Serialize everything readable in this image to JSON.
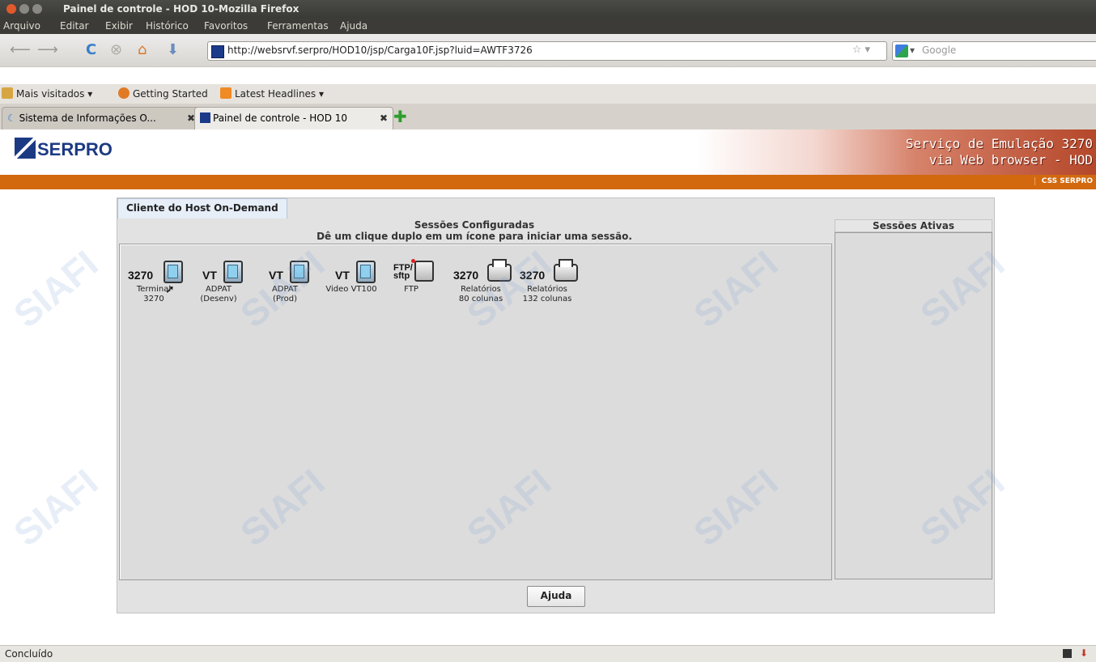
{
  "window": {
    "title": "Painel de controle - HOD 10-Mozilla Firefox"
  },
  "menu": [
    "Arquivo",
    "Editar",
    "Exibir",
    "Histórico",
    "Favoritos",
    "Ferramentas",
    "Ajuda"
  ],
  "navbar": {
    "url": "http://websrvf.serpro/HOD10/jsp/Carga10F.jsp?luid=AWTF3726",
    "search_placeholder": "Google"
  },
  "bookmarks": [
    "Mais visitados ▾",
    "Getting Started",
    "Latest Headlines ▾"
  ],
  "tabs": [
    {
      "label": "Sistema de Informações O...",
      "active": false
    },
    {
      "label": "Painel de controle - HOD 10",
      "active": true
    }
  ],
  "banner": {
    "logo": "SERPRO",
    "line1": "Serviço de Emulação 3270",
    "line2": "via Web browser - HOD",
    "footer": "CSS SERPRO"
  },
  "applet": {
    "tab": "Cliente do Host On-Demand",
    "configured_title": "Sessões Configuradas",
    "configured_hint": "Dê um clique duplo em um ícone para iniciar uma sessão.",
    "active_title": "Sessões Ativas",
    "help_button": "Ajuda",
    "sessions": [
      {
        "tag": "3270",
        "icon": "monitor-icon",
        "label1": "Terminal",
        "label2": "3270"
      },
      {
        "tag": "VT",
        "icon": "monitor-icon",
        "label1": "ADPAT",
        "label2": "(Desenv)"
      },
      {
        "tag": "VT",
        "icon": "monitor-icon",
        "label1": "ADPAT",
        "label2": "(Prod)"
      },
      {
        "tag": "VT",
        "icon": "monitor-icon",
        "label1": "Video VT100",
        "label2": ""
      },
      {
        "tag": "FTP/ sftp",
        "icon": "ftp-icon",
        "label1": "FTP",
        "label2": ""
      },
      {
        "tag": "3270",
        "icon": "printer-icon",
        "label1": "Relatórios",
        "label2": "80 colunas"
      },
      {
        "tag": "3270",
        "icon": "printer-icon",
        "label1": "Relatórios",
        "label2": "132 colunas"
      }
    ]
  },
  "status": {
    "text": "Concluído"
  },
  "watermark": "SIAFI",
  "colors": {
    "orange_bar": "#d2690f",
    "serpro_blue": "#1c3a84"
  }
}
